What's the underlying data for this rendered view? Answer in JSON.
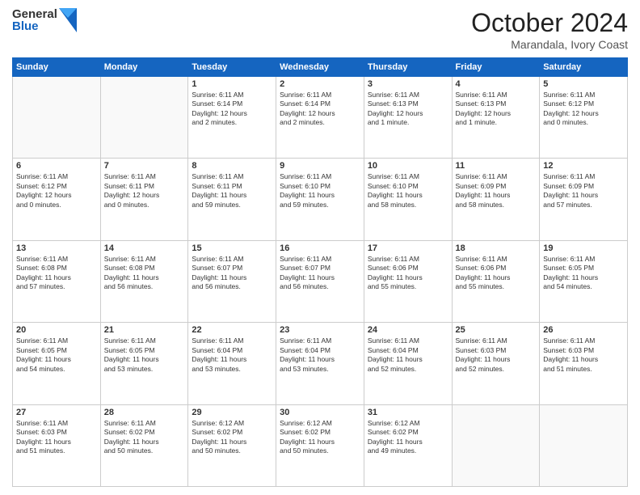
{
  "header": {
    "logo_general": "General",
    "logo_blue": "Blue",
    "month": "October 2024",
    "location": "Marandala, Ivory Coast"
  },
  "days_of_week": [
    "Sunday",
    "Monday",
    "Tuesday",
    "Wednesday",
    "Thursday",
    "Friday",
    "Saturday"
  ],
  "weeks": [
    [
      {
        "day": "",
        "content": ""
      },
      {
        "day": "",
        "content": ""
      },
      {
        "day": "1",
        "content": "Sunrise: 6:11 AM\nSunset: 6:14 PM\nDaylight: 12 hours\nand 2 minutes."
      },
      {
        "day": "2",
        "content": "Sunrise: 6:11 AM\nSunset: 6:14 PM\nDaylight: 12 hours\nand 2 minutes."
      },
      {
        "day": "3",
        "content": "Sunrise: 6:11 AM\nSunset: 6:13 PM\nDaylight: 12 hours\nand 1 minute."
      },
      {
        "day": "4",
        "content": "Sunrise: 6:11 AM\nSunset: 6:13 PM\nDaylight: 12 hours\nand 1 minute."
      },
      {
        "day": "5",
        "content": "Sunrise: 6:11 AM\nSunset: 6:12 PM\nDaylight: 12 hours\nand 0 minutes."
      }
    ],
    [
      {
        "day": "6",
        "content": "Sunrise: 6:11 AM\nSunset: 6:12 PM\nDaylight: 12 hours\nand 0 minutes."
      },
      {
        "day": "7",
        "content": "Sunrise: 6:11 AM\nSunset: 6:11 PM\nDaylight: 12 hours\nand 0 minutes."
      },
      {
        "day": "8",
        "content": "Sunrise: 6:11 AM\nSunset: 6:11 PM\nDaylight: 11 hours\nand 59 minutes."
      },
      {
        "day": "9",
        "content": "Sunrise: 6:11 AM\nSunset: 6:10 PM\nDaylight: 11 hours\nand 59 minutes."
      },
      {
        "day": "10",
        "content": "Sunrise: 6:11 AM\nSunset: 6:10 PM\nDaylight: 11 hours\nand 58 minutes."
      },
      {
        "day": "11",
        "content": "Sunrise: 6:11 AM\nSunset: 6:09 PM\nDaylight: 11 hours\nand 58 minutes."
      },
      {
        "day": "12",
        "content": "Sunrise: 6:11 AM\nSunset: 6:09 PM\nDaylight: 11 hours\nand 57 minutes."
      }
    ],
    [
      {
        "day": "13",
        "content": "Sunrise: 6:11 AM\nSunset: 6:08 PM\nDaylight: 11 hours\nand 57 minutes."
      },
      {
        "day": "14",
        "content": "Sunrise: 6:11 AM\nSunset: 6:08 PM\nDaylight: 11 hours\nand 56 minutes."
      },
      {
        "day": "15",
        "content": "Sunrise: 6:11 AM\nSunset: 6:07 PM\nDaylight: 11 hours\nand 56 minutes."
      },
      {
        "day": "16",
        "content": "Sunrise: 6:11 AM\nSunset: 6:07 PM\nDaylight: 11 hours\nand 56 minutes."
      },
      {
        "day": "17",
        "content": "Sunrise: 6:11 AM\nSunset: 6:06 PM\nDaylight: 11 hours\nand 55 minutes."
      },
      {
        "day": "18",
        "content": "Sunrise: 6:11 AM\nSunset: 6:06 PM\nDaylight: 11 hours\nand 55 minutes."
      },
      {
        "day": "19",
        "content": "Sunrise: 6:11 AM\nSunset: 6:05 PM\nDaylight: 11 hours\nand 54 minutes."
      }
    ],
    [
      {
        "day": "20",
        "content": "Sunrise: 6:11 AM\nSunset: 6:05 PM\nDaylight: 11 hours\nand 54 minutes."
      },
      {
        "day": "21",
        "content": "Sunrise: 6:11 AM\nSunset: 6:05 PM\nDaylight: 11 hours\nand 53 minutes."
      },
      {
        "day": "22",
        "content": "Sunrise: 6:11 AM\nSunset: 6:04 PM\nDaylight: 11 hours\nand 53 minutes."
      },
      {
        "day": "23",
        "content": "Sunrise: 6:11 AM\nSunset: 6:04 PM\nDaylight: 11 hours\nand 53 minutes."
      },
      {
        "day": "24",
        "content": "Sunrise: 6:11 AM\nSunset: 6:04 PM\nDaylight: 11 hours\nand 52 minutes."
      },
      {
        "day": "25",
        "content": "Sunrise: 6:11 AM\nSunset: 6:03 PM\nDaylight: 11 hours\nand 52 minutes."
      },
      {
        "day": "26",
        "content": "Sunrise: 6:11 AM\nSunset: 6:03 PM\nDaylight: 11 hours\nand 51 minutes."
      }
    ],
    [
      {
        "day": "27",
        "content": "Sunrise: 6:11 AM\nSunset: 6:03 PM\nDaylight: 11 hours\nand 51 minutes."
      },
      {
        "day": "28",
        "content": "Sunrise: 6:11 AM\nSunset: 6:02 PM\nDaylight: 11 hours\nand 50 minutes."
      },
      {
        "day": "29",
        "content": "Sunrise: 6:12 AM\nSunset: 6:02 PM\nDaylight: 11 hours\nand 50 minutes."
      },
      {
        "day": "30",
        "content": "Sunrise: 6:12 AM\nSunset: 6:02 PM\nDaylight: 11 hours\nand 50 minutes."
      },
      {
        "day": "31",
        "content": "Sunrise: 6:12 AM\nSunset: 6:02 PM\nDaylight: 11 hours\nand 49 minutes."
      },
      {
        "day": "",
        "content": ""
      },
      {
        "day": "",
        "content": ""
      }
    ]
  ]
}
